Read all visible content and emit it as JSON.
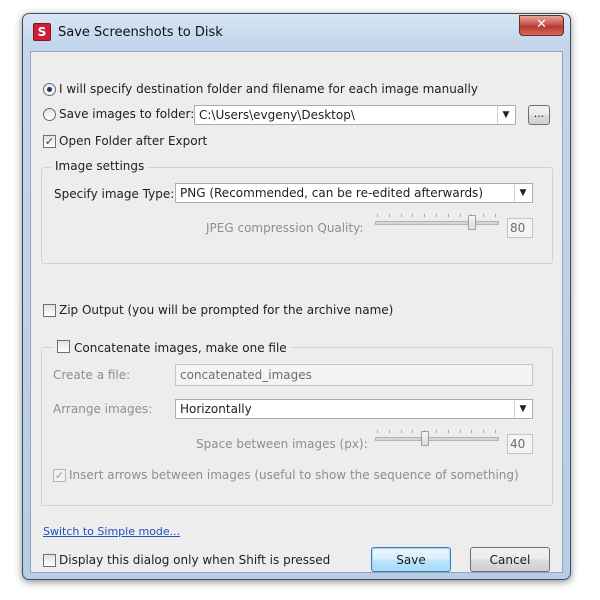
{
  "window": {
    "title": "Save Screenshots to Disk",
    "app_icon_letter": "S",
    "close_glyph": "✕"
  },
  "destination": {
    "manual_option_label": "I will specify destination folder and filename for each image manually",
    "manual_selected": true,
    "folder_option_label": "Save images to folder:",
    "folder_value": "C:\\Users\\evgeny\\Desktop\\",
    "browse_label": "...",
    "open_folder_label": "Open Folder after Export",
    "open_folder_checked": true
  },
  "image_settings": {
    "group_title": "Image settings",
    "type_label": "Specify image Type:",
    "type_value": "PNG  (Recommended, can be re-edited afterwards)",
    "jpeg_quality_label": "JPEG compression Quality:",
    "jpeg_quality_value": "80",
    "jpeg_quality_level_pct": 80
  },
  "zip": {
    "label": "Zip Output (you will be prompted for the archive name)",
    "checked": false
  },
  "concatenate": {
    "group_title": "Concatenate images, make one file",
    "checked": false,
    "create_file_label": "Create a file:",
    "create_file_value": "concatenated_images",
    "arrange_label": "Arrange images:",
    "arrange_value": "Horizontally",
    "space_label": "Space between images (px):",
    "space_value": "40",
    "space_level_pct": 40,
    "arrows_label": "Insert arrows between images (useful to show the sequence of something)",
    "arrows_checked": true
  },
  "footer": {
    "simple_mode_link": "Switch to Simple mode...",
    "shift_only_label": "Display this dialog only when Shift is pressed",
    "shift_only_checked": false,
    "save_label": "Save",
    "cancel_label": "Cancel"
  },
  "icons": {
    "dropdown_arrow": "▼",
    "checkmark": "✓"
  },
  "colors": {
    "title_bar": "#c3d6ec",
    "client_bg": "#ededed",
    "close_button": "#c75050",
    "link": "#1f53b9",
    "app_icon": "#cf1f36"
  }
}
